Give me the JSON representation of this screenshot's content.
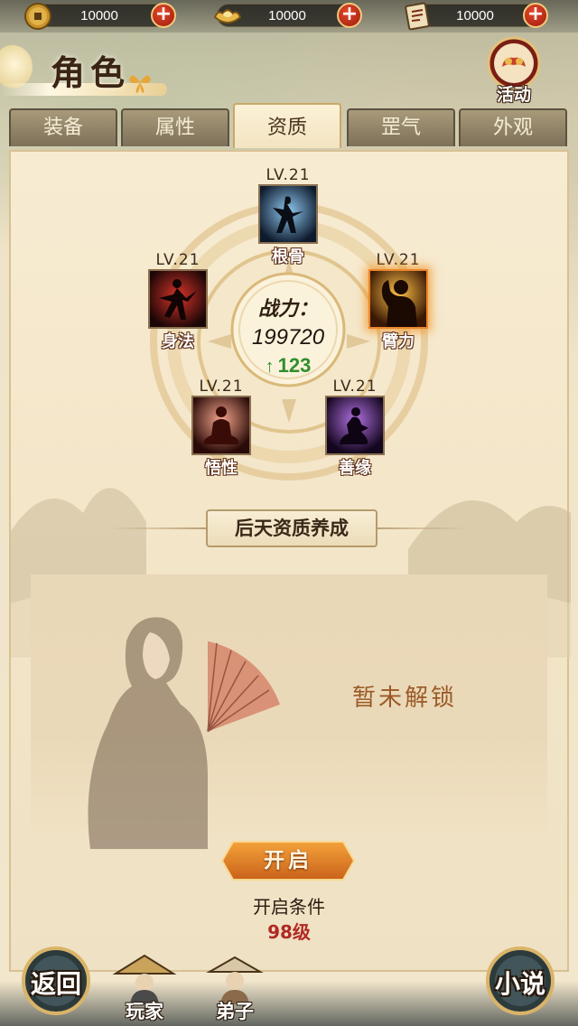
{
  "currencies": [
    {
      "name": "copper-coin",
      "value": "10000",
      "color": "#d4a43a"
    },
    {
      "name": "gold-ingot",
      "value": "10000",
      "color": "#e8b94a"
    },
    {
      "name": "ticket",
      "value": "10000",
      "color": "#e9d8b0"
    }
  ],
  "header": {
    "title": "角色",
    "activity_label": "活动"
  },
  "tabs": [
    {
      "label": "装备",
      "active": false
    },
    {
      "label": "属性",
      "active": false
    },
    {
      "label": "资质",
      "active": true
    },
    {
      "label": "罡气",
      "active": false
    },
    {
      "label": "外观",
      "active": false
    }
  ],
  "power": {
    "label": "战力：",
    "value": "199720",
    "gain": "123"
  },
  "attributes": {
    "gengu": {
      "level": "LV.21",
      "name": "根骨",
      "icon": "root-bone-icon"
    },
    "shenfa": {
      "level": "LV.21",
      "name": "身法",
      "icon": "agility-icon"
    },
    "bili": {
      "level": "LV.21",
      "name": "臂力",
      "icon": "strength-icon"
    },
    "wuxing": {
      "level": "LV.21",
      "name": "悟性",
      "icon": "comprehension-icon"
    },
    "shanyuan": {
      "level": "LV.21",
      "name": "善缘",
      "icon": "karma-icon"
    }
  },
  "section": {
    "title": "后天资质养成"
  },
  "locked": {
    "text": "暂未解锁",
    "button_label": "开启",
    "condition_label": "开启条件",
    "condition_value": "98级"
  },
  "bottom_nav": {
    "back": "返回",
    "player": "玩家",
    "disciple": "弟子",
    "novel": "小说"
  },
  "colors": {
    "accent_orange": "#e8862c",
    "gain_green": "#2f8f2c",
    "condition_red": "#b02a24"
  }
}
